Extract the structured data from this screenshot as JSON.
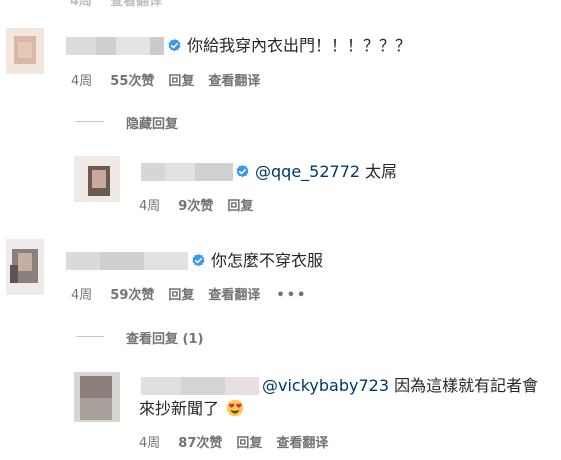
{
  "comments": [
    {
      "text": "你給我穿內衣出門！！！？？？",
      "meta": {
        "age": "4周",
        "likes": "55次赞",
        "reply": "回复",
        "translate": "查看翻译"
      },
      "replies_toggle": {
        "label": "隐藏回复"
      },
      "replies": [
        {
          "mention": "@qqe_52772",
          "text": " 太屌",
          "meta": {
            "age": "4周",
            "likes": "9次赞",
            "reply": "回复"
          }
        }
      ]
    },
    {
      "text": "你怎麼不穿衣服",
      "meta": {
        "age": "4周",
        "likes": "59次赞",
        "reply": "回复",
        "translate": "查看翻译",
        "more": "•••"
      },
      "replies_toggle": {
        "label": "查看回复 (1)"
      },
      "replies": [
        {
          "mention": "@vickybaby723",
          "text": " 因為這樣就有記者會",
          "text_line2": "來抄新聞了",
          "emoji": "heart-eyes-icon",
          "meta": {
            "age": "4周",
            "likes": "87次赞",
            "reply": "回复",
            "translate": "查看翻译"
          }
        }
      ]
    }
  ],
  "colors": {
    "verified": "#3897f0",
    "mention": "#00376b",
    "meta": "#737373"
  }
}
